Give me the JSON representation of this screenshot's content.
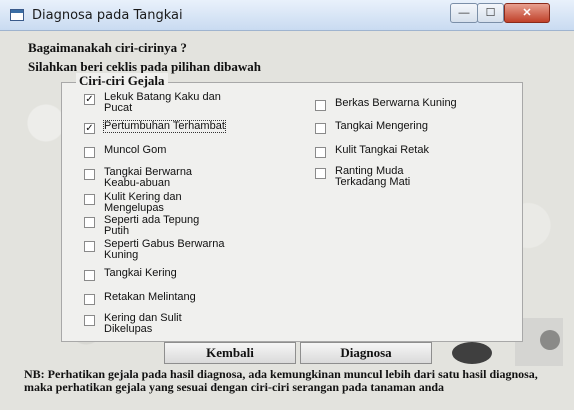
{
  "window": {
    "title": "Diagnosa pada Tangkai"
  },
  "header": {
    "question": "Bagaimanakah ciri-cirinya ?",
    "instruction": "Silahkan beri ceklis pada pilihan dibawah"
  },
  "group": {
    "legend": "Ciri-ciri Gejala",
    "left": [
      {
        "label": "Lekuk Batang Kaku dan\nPucat",
        "checked": true
      },
      {
        "label": "Pertumbuhan Terhambat",
        "checked": true
      },
      {
        "label": "Muncol Gom",
        "checked": false
      },
      {
        "label": "Tangkai Berwarna\nKeabu-abuan",
        "checked": false
      },
      {
        "label": "Kulit Kering dan\nMengelupas",
        "checked": false
      },
      {
        "label": "Seperti ada Tepung\nPutih",
        "checked": false
      },
      {
        "label": "Seperti Gabus Berwarna\nKuning",
        "checked": false
      },
      {
        "label": "Tangkai Kering",
        "checked": false
      },
      {
        "label": "Retakan Melintang",
        "checked": false
      },
      {
        "label": "Kering dan Sulit\nDikelupas",
        "checked": false
      }
    ],
    "right": [
      {
        "label": "Berkas Berwarna Kuning",
        "checked": false
      },
      {
        "label": "Tangkai Mengering",
        "checked": false
      },
      {
        "label": "Kulit Tangkai Retak",
        "checked": false
      },
      {
        "label": "Ranting Muda\nTerkadang Mati",
        "checked": false
      }
    ]
  },
  "buttons": {
    "back": "Kembali",
    "diagnose": "Diagnosa"
  },
  "note": "NB: Perhatikan gejala pada hasil diagnosa,  ada kemungkinan muncul lebih dari satu hasil diagnosa, maka perhatikan gejala yang sesuai dengan ciri-ciri serangan pada tanaman anda",
  "window_controls": {
    "minimize": "—",
    "maximize": "☐",
    "close": "✕"
  }
}
